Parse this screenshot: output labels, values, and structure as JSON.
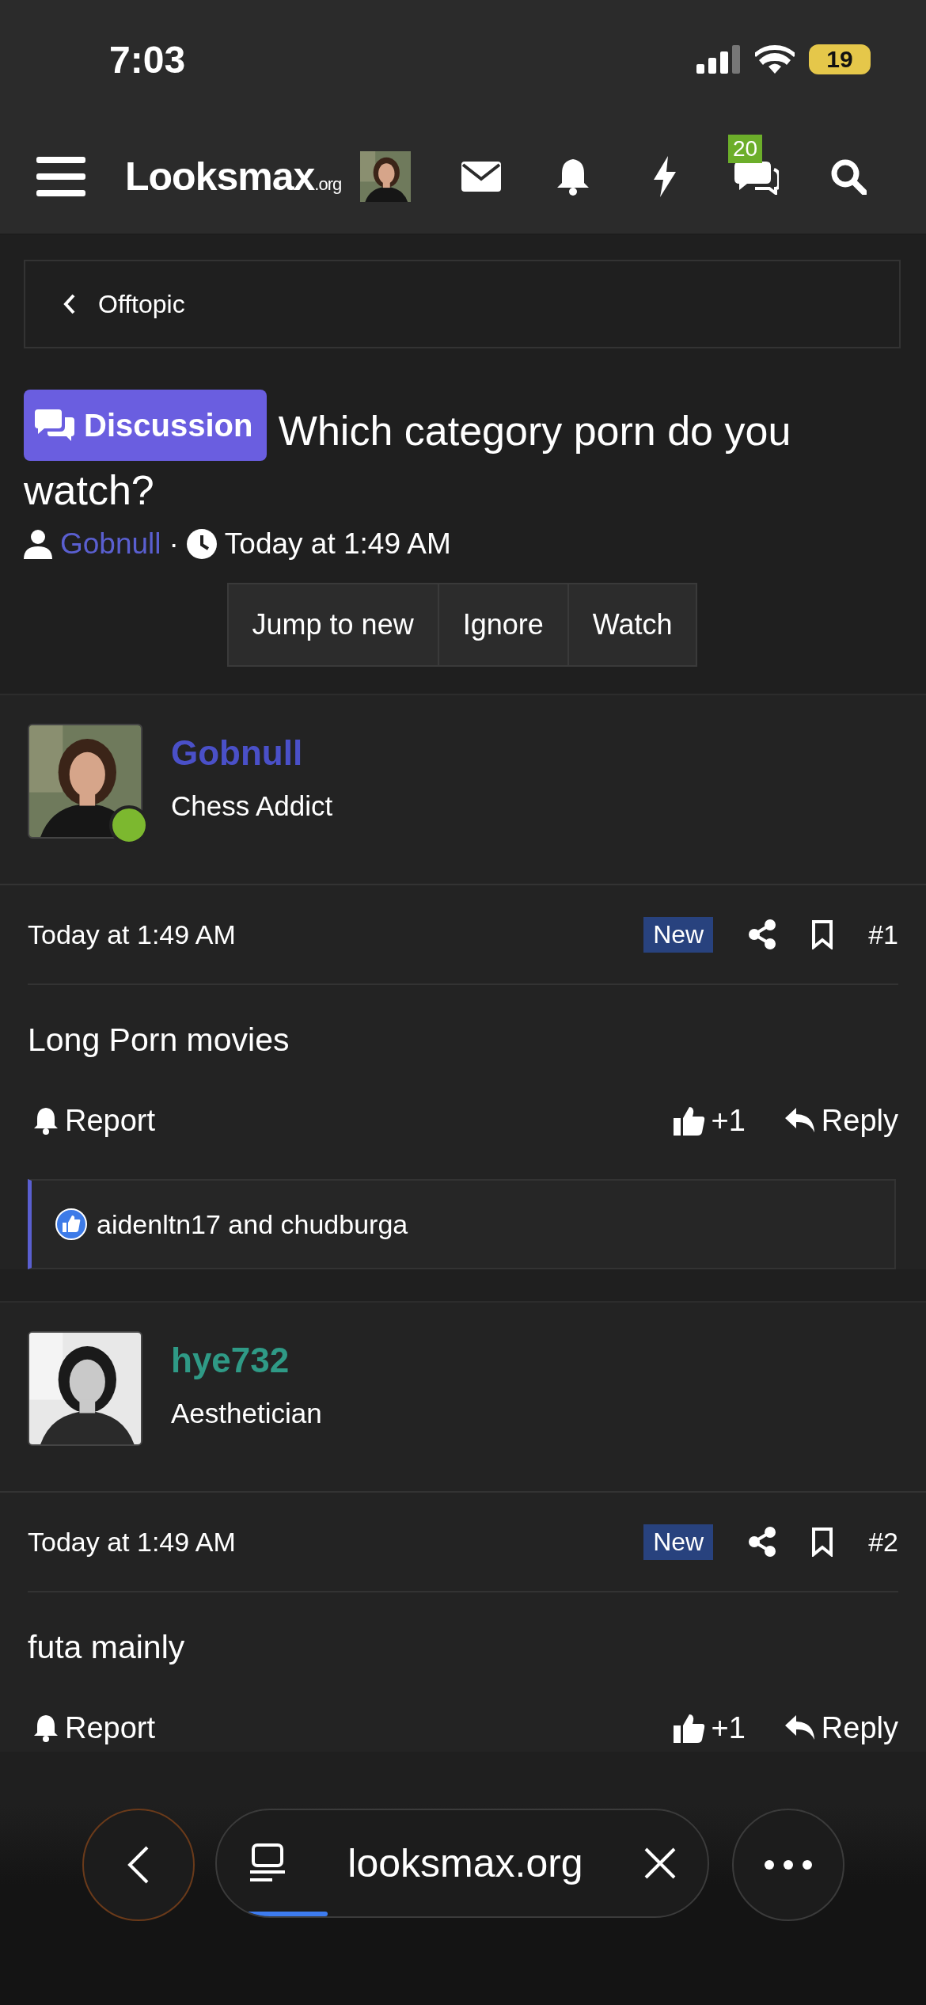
{
  "status_bar": {
    "time": "7:03",
    "battery": "19"
  },
  "header": {
    "logo": "Looksmax",
    "logo_suffix": ".org",
    "chat_badge": "20"
  },
  "breadcrumb": {
    "label": "Offtopic"
  },
  "thread": {
    "prefix": "Discussion",
    "title": "Which category porn do you watch?",
    "author": "Gobnull",
    "separator": "·",
    "date": "Today at 1:49 AM"
  },
  "buttons": [
    "Jump to new",
    "Ignore",
    "Watch"
  ],
  "posts": [
    {
      "username": "Gobnull",
      "color": "#4a50c8",
      "user_title": "Chess Addict",
      "online": true,
      "date": "Today at 1:49 AM",
      "badge": "New",
      "number": "#1",
      "body": "Long Porn movies",
      "report": "Report",
      "likes": "+1",
      "reply": "Reply",
      "reactions": "aidenltn17 and chudburga"
    },
    {
      "username": "hye732",
      "color": "#2f9a86",
      "user_title": "Aesthetician",
      "online": false,
      "date": "Today at 1:49 AM",
      "badge": "New",
      "number": "#2",
      "body": "futa mainly",
      "report": "Report",
      "likes": "+1",
      "reply": "Reply"
    }
  ],
  "browser": {
    "url": "looksmax.org"
  }
}
